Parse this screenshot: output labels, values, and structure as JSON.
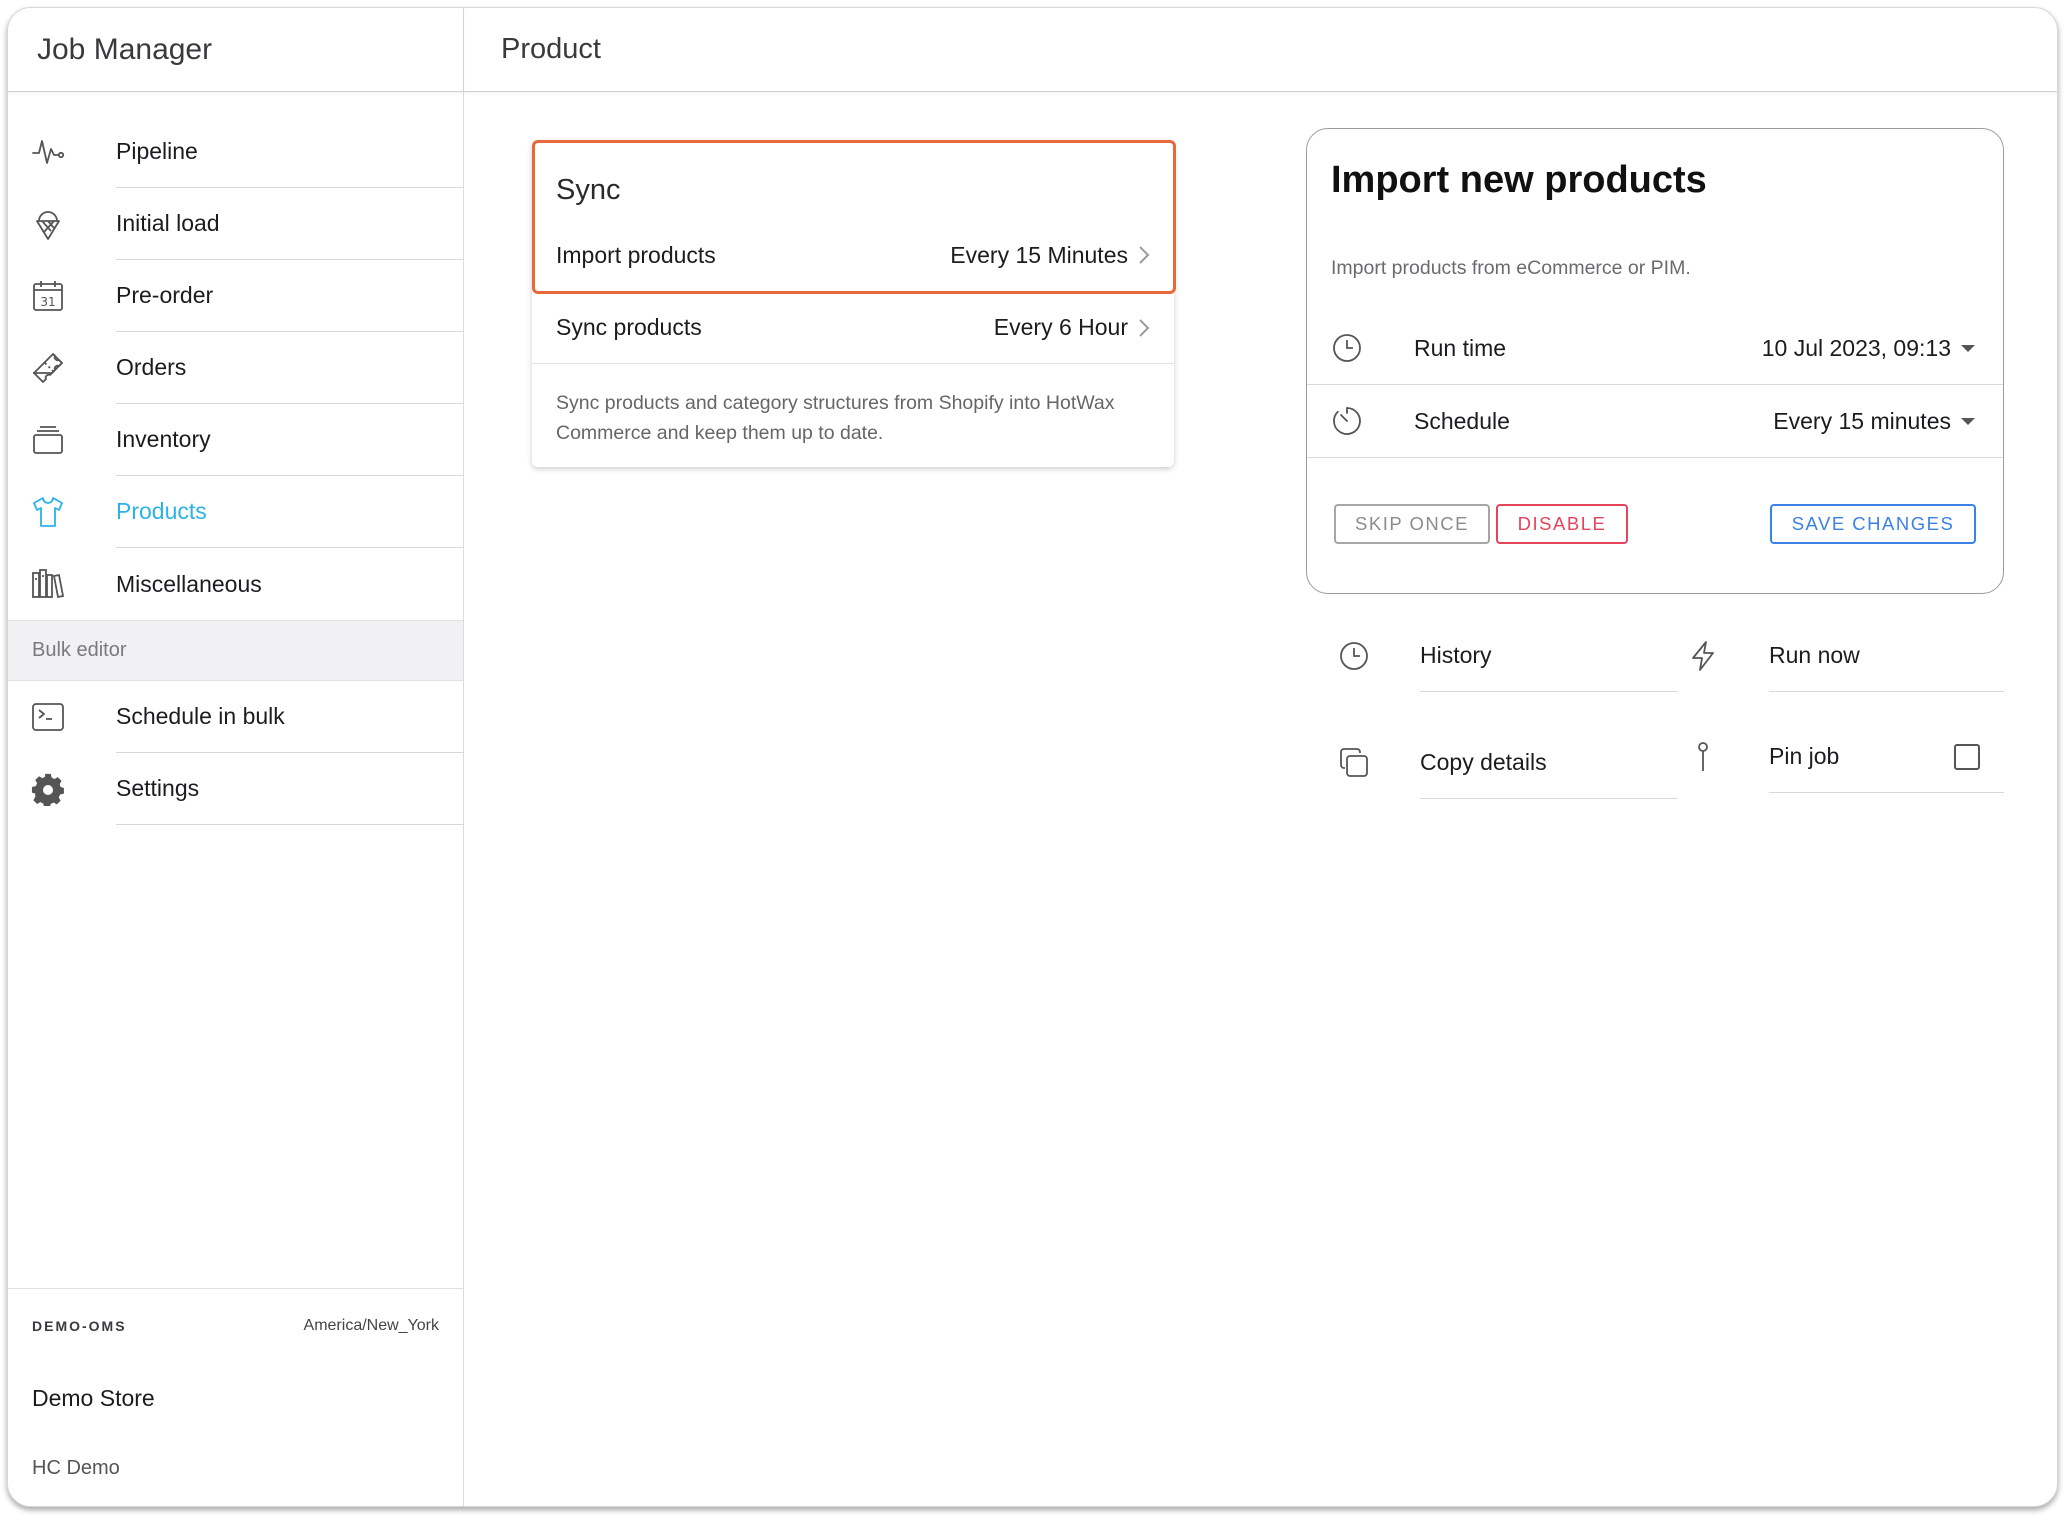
{
  "app": {
    "title": "Job Manager"
  },
  "page": {
    "title": "Product"
  },
  "sidebar": {
    "items": [
      {
        "label": "Pipeline",
        "icon": "pulse-icon"
      },
      {
        "label": "Initial load",
        "icon": "ice-cream-icon"
      },
      {
        "label": "Pre-order",
        "icon": "calendar-icon"
      },
      {
        "label": "Orders",
        "icon": "ticket-icon"
      },
      {
        "label": "Inventory",
        "icon": "albums-icon"
      },
      {
        "label": "Products",
        "icon": "shirt-icon",
        "active": true
      },
      {
        "label": "Miscellaneous",
        "icon": "library-icon"
      }
    ],
    "section_header": "Bulk editor",
    "bulk_items": [
      {
        "label": "Schedule in bulk",
        "icon": "terminal-icon"
      },
      {
        "label": "Settings",
        "icon": "gear-icon"
      }
    ],
    "footer": {
      "instance": "DEMO-OMS",
      "timezone": "America/New_York",
      "store": "Demo Store",
      "brand": "HC Demo"
    },
    "active_color": "#2bb3e8"
  },
  "sync_card": {
    "title": "Sync",
    "rows": [
      {
        "label": "Import products",
        "value": "Every 15 Minutes"
      },
      {
        "label": "Sync products",
        "value": "Every 6 Hour"
      }
    ],
    "description": "Sync products and category structures from Shopify into HotWax Commerce and keep them up to date.",
    "highlight_color": "#e8693a"
  },
  "detail_card": {
    "title": "Import new products",
    "description": "Import products from eCommerce or PIM.",
    "run_time": {
      "label": "Run time",
      "value": "10 Jul 2023, 09:13"
    },
    "schedule": {
      "label": "Schedule",
      "value": "Every 15 minutes"
    },
    "buttons": {
      "skip": "SKIP ONCE",
      "disable": "DISABLE",
      "save": "SAVE CHANGES"
    }
  },
  "actions": {
    "history": "History",
    "run_now": "Run now",
    "copy_details": "Copy details",
    "pin_job": "Pin job"
  }
}
